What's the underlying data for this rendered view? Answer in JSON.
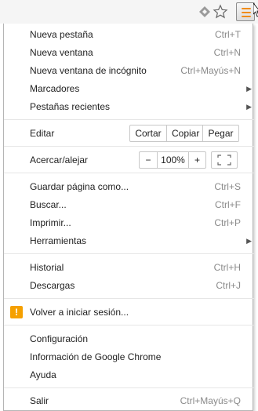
{
  "menu": {
    "group1": [
      {
        "label": "Nueva pestaña",
        "shortcut": "Ctrl+T"
      },
      {
        "label": "Nueva ventana",
        "shortcut": "Ctrl+N"
      },
      {
        "label": "Nueva ventana de incógnito",
        "shortcut": "Ctrl+Mayús+N"
      },
      {
        "label": "Marcadores",
        "shortcut": ""
      },
      {
        "label": "Pestañas recientes",
        "shortcut": ""
      }
    ],
    "edit": {
      "label": "Editar",
      "cut": "Cortar",
      "copy": "Copiar",
      "paste": "Pegar"
    },
    "zoom": {
      "label": "Acercar/alejar",
      "minus": "−",
      "value": "100%",
      "plus": "+"
    },
    "group2": [
      {
        "label": "Guardar página como...",
        "shortcut": "Ctrl+S"
      },
      {
        "label": "Buscar...",
        "shortcut": "Ctrl+F"
      },
      {
        "label": "Imprimir...",
        "shortcut": "Ctrl+P"
      },
      {
        "label": "Herramientas",
        "shortcut": ""
      }
    ],
    "group3": [
      {
        "label": "Historial",
        "shortcut": "Ctrl+H"
      },
      {
        "label": "Descargas",
        "shortcut": "Ctrl+J"
      }
    ],
    "signin": {
      "label": "Volver a iniciar sesión...",
      "icon_glyph": "!"
    },
    "group4": [
      {
        "label": "Configuración"
      },
      {
        "label": "Información de Google Chrome"
      },
      {
        "label": "Ayuda"
      }
    ],
    "exit": {
      "label": "Salir",
      "shortcut": "Ctrl+Mayús+Q"
    }
  },
  "colors": {
    "accent": "#f08c1a",
    "warning": "#f5a000",
    "shortcut": "#8a8a8a"
  }
}
